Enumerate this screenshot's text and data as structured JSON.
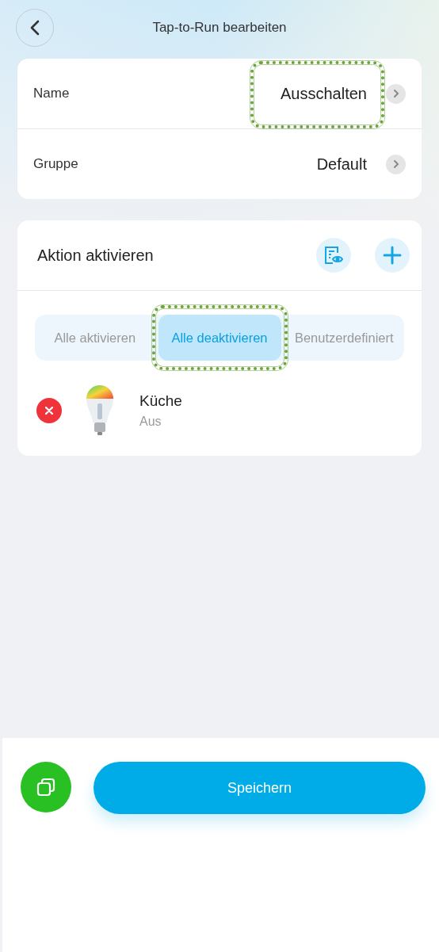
{
  "header": {
    "title": "Tap-to-Run bearbeiten"
  },
  "settings": [
    {
      "label": "Name",
      "value": "Ausschalten",
      "highlighted": true
    },
    {
      "label": "Gruppe",
      "value": "Default",
      "highlighted": false
    }
  ],
  "actions": {
    "title": "Aktion aktivieren",
    "modes": [
      {
        "label": "Alle aktivieren",
        "selected": false,
        "highlighted": false
      },
      {
        "label": "Alle deaktivieren",
        "selected": true,
        "highlighted": true
      },
      {
        "label": "Benutzerdefiniert",
        "selected": false,
        "highlighted": false
      }
    ],
    "devices": [
      {
        "name": "Küche",
        "status": "Aus"
      }
    ]
  },
  "footer": {
    "save_label": "Speichern"
  }
}
